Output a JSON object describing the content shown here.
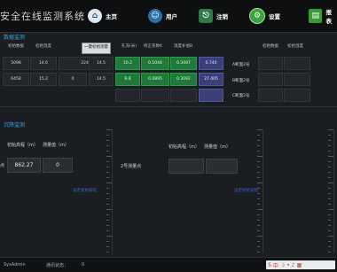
{
  "app": {
    "title": "安全在线监测系统"
  },
  "nav": [
    {
      "label": "主页",
      "icon": "home-icon"
    },
    {
      "label": "用户",
      "icon": "users-icon"
    },
    {
      "label": "注销",
      "icon": "logout-icon"
    },
    {
      "label": "设置",
      "icon": "gear-icon"
    },
    {
      "label": "报表",
      "icon": "report-icon"
    }
  ],
  "section1": {
    "title": "数据监测"
  },
  "table_headers": [
    "初始数据",
    "初始温度",
    "一键初始测量",
    "孔深(米)",
    "修正系数K",
    "温度补偿B",
    "初始数据",
    "初始温度"
  ],
  "rows": [
    {
      "c1": "5098",
      "c2": "14.6",
      "c3": "2242",
      "c4": "14.5",
      "g1": "10.2",
      "g2": "0.1044",
      "g3": "0.3497",
      "p": "0.740"
    },
    {
      "c1": "6458",
      "c2": "15.2",
      "c3": "0",
      "c4": "14.5",
      "g1": "9.8",
      "g2": "0.0895",
      "g3": "0.3092",
      "p": "27.405"
    }
  ],
  "right_rows": [
    "A断面2号",
    "B断面2号",
    "C断面2号"
  ],
  "section2": {
    "title": "沉降监测"
  },
  "settle": {
    "left": {
      "h1": "初始高程（m）",
      "h2": "测量值（m）",
      "row_label": "点",
      "v1": "862.27",
      "v2": "0",
      "link": "设定初始高程"
    },
    "right": {
      "h1": "初始高程（m）",
      "h2": "测量值（m）",
      "row_label": "2号测量点",
      "v1": "",
      "v2": "",
      "link": "设定初始高程"
    }
  },
  "status": {
    "user": "SysAdmin",
    "conn_label": "通讯状态：",
    "conn_value": "0"
  }
}
